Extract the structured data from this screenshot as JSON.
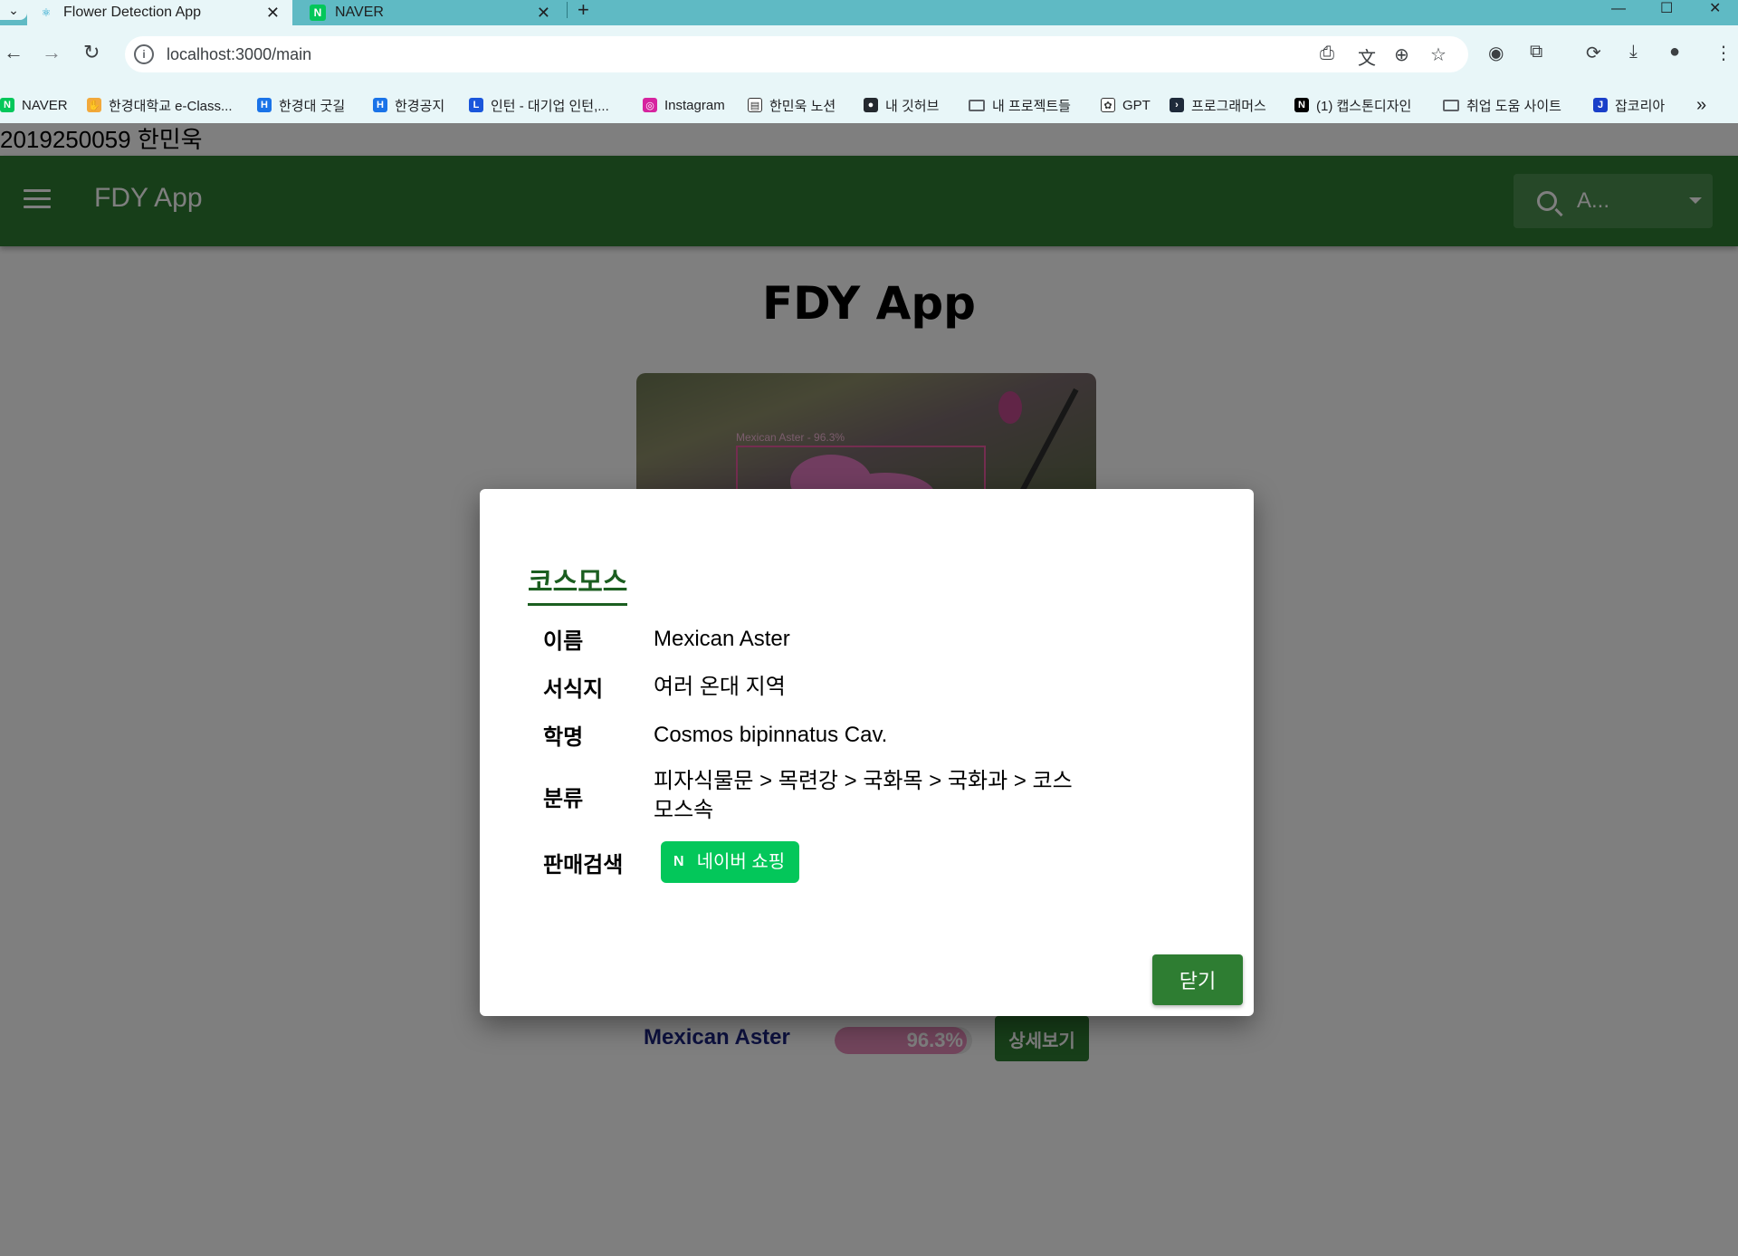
{
  "browser": {
    "tabs": [
      {
        "title": "Flower Detection App",
        "active": true
      },
      {
        "title": "NAVER",
        "active": false
      }
    ],
    "url": "localhost:3000/main",
    "bookmarks": [
      {
        "label": "NAVER",
        "icon": "naver-icon"
      },
      {
        "label": "한경대학교 e-Class...",
        "icon": "hand-icon"
      },
      {
        "label": "한경대 굿길",
        "icon": "h-icon"
      },
      {
        "label": "한경공지",
        "icon": "h-icon"
      },
      {
        "label": "인턴 - 대기업 인턴,...",
        "icon": "l-icon"
      },
      {
        "label": "Instagram",
        "icon": "instagram-icon"
      },
      {
        "label": "한민욱 노션",
        "icon": "doc-icon"
      },
      {
        "label": "내 깃허브",
        "icon": "github-icon"
      },
      {
        "label": "내 프로젝트들",
        "icon": "folder-icon"
      },
      {
        "label": "GPT",
        "icon": "gpt-icon"
      },
      {
        "label": "프로그래머스",
        "icon": "programmers-icon"
      },
      {
        "label": "(1) 캡스톤디자인",
        "icon": "notion-icon"
      },
      {
        "label": "취업 도움 사이트",
        "icon": "folder-icon"
      },
      {
        "label": "잡코리아",
        "icon": "j-icon"
      }
    ]
  },
  "page": {
    "student_info": "2019250059 한민욱",
    "appbar": {
      "title": "FDY App",
      "search_text": "A..."
    },
    "main_title": "FDY App",
    "image_label": "Mexican Aster - 96.3%",
    "result": {
      "name": "Mexican Aster",
      "percent_text": "96.3%",
      "confidence": 0.963,
      "detail_button": "상세보기"
    }
  },
  "modal": {
    "title": "코스모스",
    "rows": [
      {
        "label": "이름",
        "value": "Mexican Aster"
      },
      {
        "label": "서식지",
        "value": "여러 온대 지역"
      },
      {
        "label": "학명",
        "value": "Cosmos bipinnatus Cav."
      },
      {
        "label": "분류",
        "value": "피자식물문 > 목련강 > 국화목 > 국화과 > 코스모스속"
      }
    ],
    "shop_label": "판매검색",
    "naver_shop_button": "네이버 쇼핑",
    "close_button": "닫기"
  },
  "colors": {
    "appbar": "#2e7d32",
    "modal_title": "#1b5e20",
    "naver_green": "#03c75a",
    "result_name": "#1a237e"
  }
}
